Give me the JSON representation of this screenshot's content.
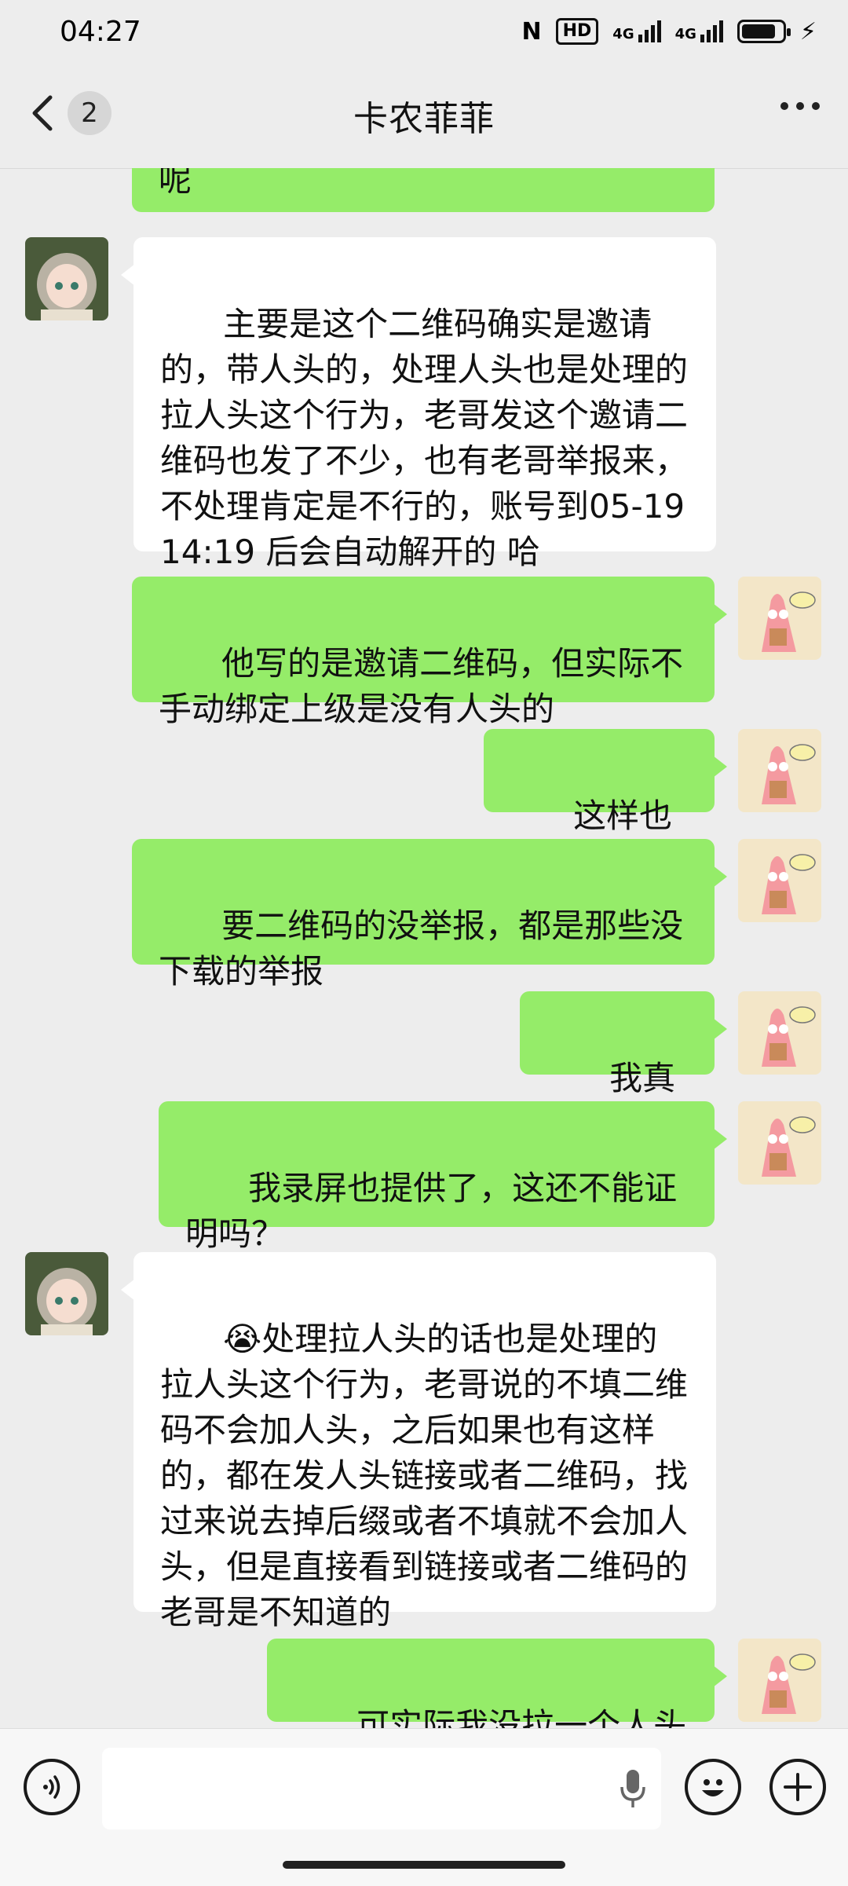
{
  "status": {
    "time": "04:27",
    "nfc": "N",
    "hd": "HD",
    "net1": "4G",
    "net2": "4G"
  },
  "header": {
    "unread": "2",
    "title": "卡农菲菲"
  },
  "messages": [
    {
      "side": "right",
      "text": "呢"
    },
    {
      "side": "left",
      "text": "主要是这个二维码确实是邀请的，带人头的，处理人头也是处理的拉人头这个行为，老哥发这个邀请二维码也发了不少，也有老哥举报来，不处理肯定是不行的，账号到05-19 14:19 后会自动解开的 哈"
    },
    {
      "side": "right",
      "text": "他写的是邀请二维码，但实际不手动绑定上级是没有人头的"
    },
    {
      "side": "right",
      "text": "这样也不行"
    },
    {
      "side": "right",
      "text": "要二维码的没举报，都是那些没下载的举报"
    },
    {
      "side": "right",
      "text": "我真服了"
    },
    {
      "side": "right",
      "text": "我录屏也提供了，这还不能证明吗？"
    },
    {
      "side": "left",
      "emoji": "😭",
      "text": "处理拉人头的话也是处理的拉人头这个行为，老哥说的不填二维码不会加人头，之后如果也有这样的，都在发人头链接或者二维码，找过来说去掉后缀或者不填就不会加人头，但是直接看到链接或者二维码的老哥是不知道的"
    },
    {
      "side": "right",
      "text": "可实际我没拉一个人头啊"
    }
  ],
  "colors": {
    "self_bubble": "#95ec69",
    "other_bubble": "#ffffff",
    "background": "#ededed"
  },
  "icons": [
    "back-chevron-icon",
    "more-icon",
    "voice-icon",
    "microphone-icon",
    "emoji-icon",
    "plus-icon"
  ]
}
